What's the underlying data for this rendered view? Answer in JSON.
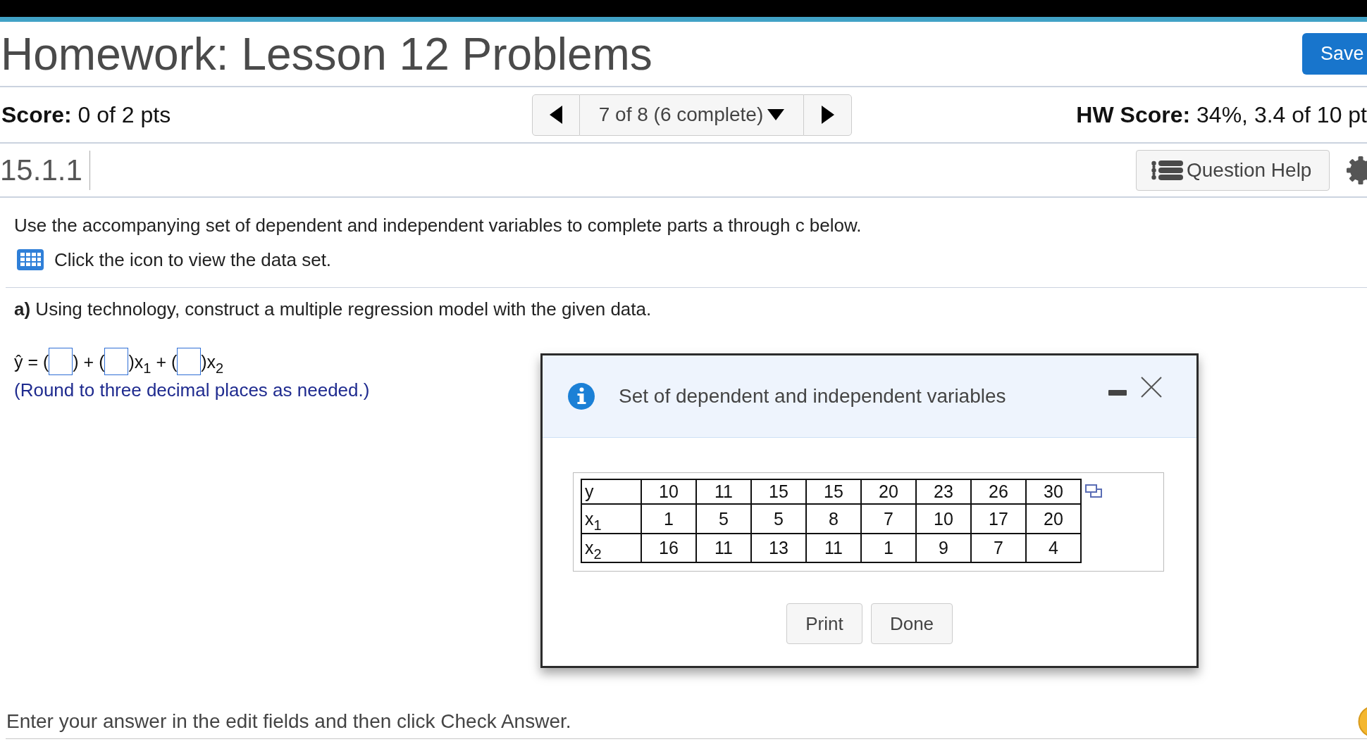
{
  "header": {
    "title": "Homework: Lesson 12 Problems",
    "save_button": "Save"
  },
  "score_bar": {
    "score": "**Score:** 0 of 2 pts",
    "navigator": {
      "position": "7 of 8 (6 complete)"
    },
    "hw_score": "**HW Score:** 34%, 3.4 of 10 pt"
  },
  "question_bar": {
    "number": "15.1.1",
    "help_button": "Question Help"
  },
  "question": {
    "instruction": "Use the accompanying set of dependent and independent variables to complete parts a through c below.",
    "data_link": "Click the icon to view the data set.",
    "part_a": "**a)** Using technology, construct a multiple regression model with the given data.",
    "equation": [
      {
        "kind": "text",
        "text": "ŷ = ("
      },
      {
        "kind": "blank"
      },
      {
        "kind": "text",
        "text": ") + ("
      },
      {
        "kind": "blank"
      },
      {
        "kind": "text",
        "text": ")x$_{1}$ + ("
      },
      {
        "kind": "blank"
      },
      {
        "kind": "text",
        "text": ")x$_{2}$"
      }
    ],
    "note": "(Round to three decimal places as needed.)"
  },
  "dialog": {
    "title": "Set of dependent and independent variables",
    "table": [
      {
        "label": "y",
        "values": [
          "10",
          "11",
          "15",
          "15",
          "20",
          "23",
          "26",
          "30"
        ]
      },
      {
        "label": "x$_{1}$",
        "values": [
          "1",
          "5",
          "5",
          "8",
          "7",
          "10",
          "17",
          "20"
        ]
      },
      {
        "label": "x$_{2}$",
        "values": [
          "16",
          "11",
          "13",
          "11",
          "1",
          "9",
          "7",
          "4"
        ]
      }
    ],
    "buttons": [
      "Print",
      "Done"
    ]
  },
  "footer": {
    "message": "Enter your answer in the edit fields and then click Check Answer."
  }
}
